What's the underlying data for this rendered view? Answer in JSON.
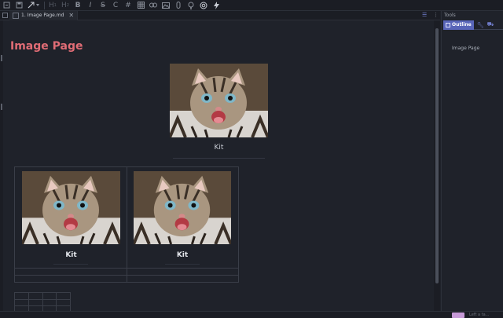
{
  "toolbar": {
    "items": [
      "file-icon",
      "save-icon",
      "expand-icon",
      "header-1-icon",
      "header-2-icon",
      "bold-icon",
      "italic-icon",
      "strikethrough-icon",
      "code-icon",
      "hash-icon",
      "table-icon",
      "link-icon",
      "image-icon",
      "attachment-icon",
      "bulb-icon",
      "settings-icon",
      "lightning-icon"
    ],
    "h1_label": "H",
    "h2_label": "H",
    "bold_label": "B",
    "italic_label": "I",
    "strike_label": "S",
    "code_label": "C",
    "hash_label": "#"
  },
  "tab": {
    "label": "1. Image Page.md",
    "close": "✕"
  },
  "editor": {
    "title": "Image Page",
    "image_caption": "Kit",
    "table": {
      "cells": [
        {
          "caption": "Kit"
        },
        {
          "caption": "Kit"
        }
      ]
    }
  },
  "tools": {
    "title": "Tools",
    "outline_tab": "Outline",
    "outline_items": [
      "Image Page"
    ]
  },
  "status": {
    "text": "Left a ta..."
  },
  "colors": {
    "accent": "#5865b8",
    "title": "#e06c75",
    "background": "#1f222a"
  }
}
